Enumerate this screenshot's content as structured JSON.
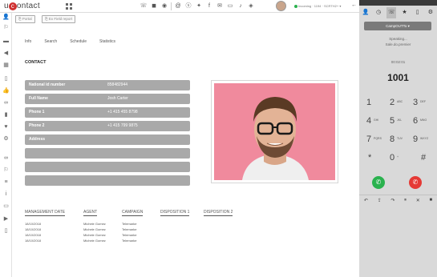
{
  "header": {
    "logo_prefix": "u",
    "logo_o": "c",
    "logo_suffix": "ontact",
    "status": "Incoming · 1194 · SCRTH2+",
    "icons": [
      "grid-icon",
      "phone-icon",
      "chat-icon",
      "chat2-icon",
      "mail-icon",
      "at-icon",
      "skype-icon",
      "twitter-icon",
      "facebook-icon",
      "email-icon",
      "sms-icon",
      "bell-icon",
      "chat3-icon"
    ]
  },
  "sidebar": {
    "icons": [
      "user-icon",
      "flag-icon",
      "truck-icon",
      "speaker-icon",
      "grid-icon",
      "doc-icon",
      "thumb-icon",
      "link-icon",
      "bars-icon",
      "heart-icon",
      "gears-icon",
      "link2-icon",
      "flag2-icon",
      "list-icon",
      "info-icon",
      "folder-icon",
      "play-icon",
      "doc2-icon"
    ]
  },
  "toolbar": {
    "portal_label": "Portal",
    "ext_field_label": "Ex Field report"
  },
  "tabs": [
    "Info",
    "Search",
    "Schedule",
    "Statistics"
  ],
  "section_title": "CONTACT",
  "contact_fields": [
    {
      "label": "National id number",
      "value": "858482944"
    },
    {
      "label": "Full Name",
      "value": "Josh Carter"
    },
    {
      "label": "Phone 1",
      "value": "+1 415 455 8798"
    },
    {
      "label": "Phone 2",
      "value": "+1 415 799 9875"
    },
    {
      "label": "Address",
      "value": ""
    },
    {
      "label": "",
      "value": ""
    },
    {
      "label": "",
      "value": ""
    },
    {
      "label": "",
      "value": ""
    }
  ],
  "management": {
    "headers": [
      "MANAGEMENT DATE",
      "AGENT",
      "CAMPAIGN",
      "DISPOSITION 1",
      "DISPOSITION 2"
    ],
    "rows": [
      [
        "18/10/2018",
        "Michele Gomez",
        "Telemarke"
      ],
      [
        "18/10/2018",
        "Michele Gomez",
        "Telemarke"
      ],
      [
        "18/10/2018",
        "Michele Gomez",
        "Telemarke"
      ],
      [
        "18/10/2018",
        "Michele Gomez",
        "Telemarke"
      ]
    ]
  },
  "phone": {
    "campaign": "CampOUTTo",
    "speaking": "Speaking...",
    "speaking_sub": "Sale.do.premier",
    "timer": "00:02:01",
    "extension": "1001",
    "keys": [
      {
        "d": "1",
        "l": ""
      },
      {
        "d": "2",
        "l": "ABC"
      },
      {
        "d": "3",
        "l": "DEF"
      },
      {
        "d": "4",
        "l": "GHI"
      },
      {
        "d": "5",
        "l": "JKL"
      },
      {
        "d": "6",
        "l": "MNO"
      },
      {
        "d": "7",
        "l": "PQRS"
      },
      {
        "d": "8",
        "l": "TUV"
      },
      {
        "d": "9",
        "l": "WXYZ"
      },
      {
        "d": "*",
        "l": ""
      },
      {
        "d": "0",
        "l": "+"
      },
      {
        "d": "#",
        "l": ""
      }
    ],
    "call_color": "#2ab24e",
    "hangup_color": "#e53935"
  }
}
